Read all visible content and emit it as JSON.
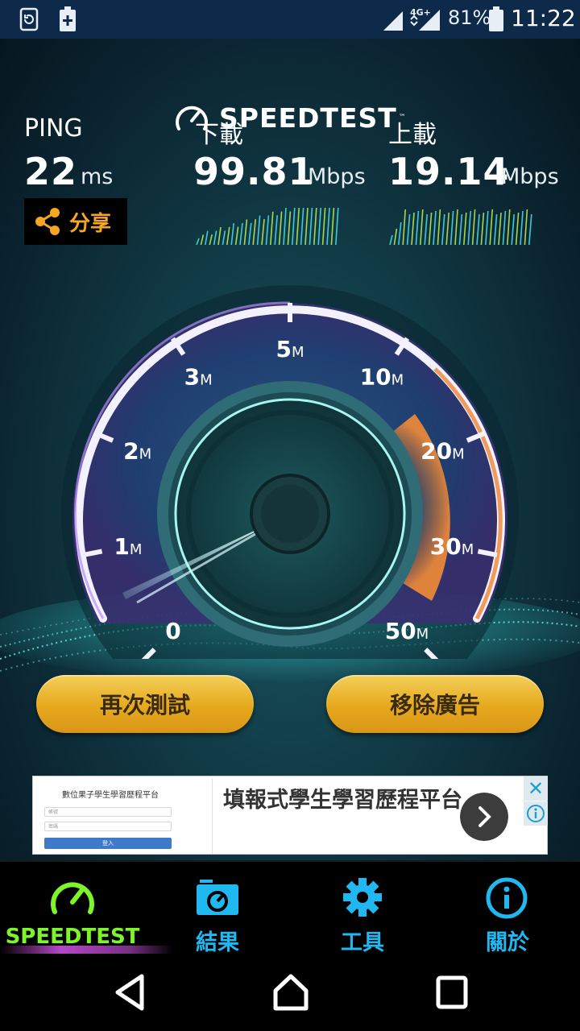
{
  "status_bar": {
    "network": "4G+",
    "battery": "81%",
    "time": "11:22",
    "icons": [
      "sync-icon",
      "battery-plus-icon",
      "signal-icon",
      "battery-icon"
    ]
  },
  "app": {
    "logo": "SPEEDTEST",
    "ping": {
      "label": "PING",
      "value": "22",
      "unit": "ms"
    },
    "download": {
      "label": "下載",
      "value": "99.81",
      "unit": "Mbps"
    },
    "upload": {
      "label": "上載",
      "value": "19.14",
      "unit": "Mbps"
    },
    "share_label": "分享",
    "gauge": {
      "ticks": [
        {
          "num": "0",
          "unit": ""
        },
        {
          "num": "1",
          "unit": "M"
        },
        {
          "num": "2",
          "unit": "M"
        },
        {
          "num": "3",
          "unit": "M"
        },
        {
          "num": "5",
          "unit": "M"
        },
        {
          "num": "10",
          "unit": "M"
        },
        {
          "num": "20",
          "unit": "M"
        },
        {
          "num": "30",
          "unit": "M"
        },
        {
          "num": "50",
          "unit": "M"
        }
      ]
    },
    "buttons": {
      "retest": "再次測試",
      "remove_ads": "移除廣告"
    }
  },
  "ad": {
    "thumb_title": "數位果子學生學習歷程平台",
    "thumb_field1": "帳號",
    "thumb_field2": "密碼",
    "thumb_button": "登入",
    "headline": "填報式學生學習歷程平台",
    "close": "✕"
  },
  "tabs": [
    {
      "label": "SPEEDTEST",
      "icon": "speedometer-icon",
      "active": true
    },
    {
      "label": "結果",
      "icon": "results-folder-icon",
      "active": false
    },
    {
      "label": "工具",
      "icon": "gear-icon",
      "active": false
    },
    {
      "label": "關於",
      "icon": "info-icon",
      "active": false
    }
  ],
  "colors": {
    "accent_green": "#7ef529",
    "accent_blue": "#1fb8f0",
    "button_gold": "#e6a91c",
    "share_orange": "#f5a623",
    "gauge_orange": "#e8873a"
  }
}
